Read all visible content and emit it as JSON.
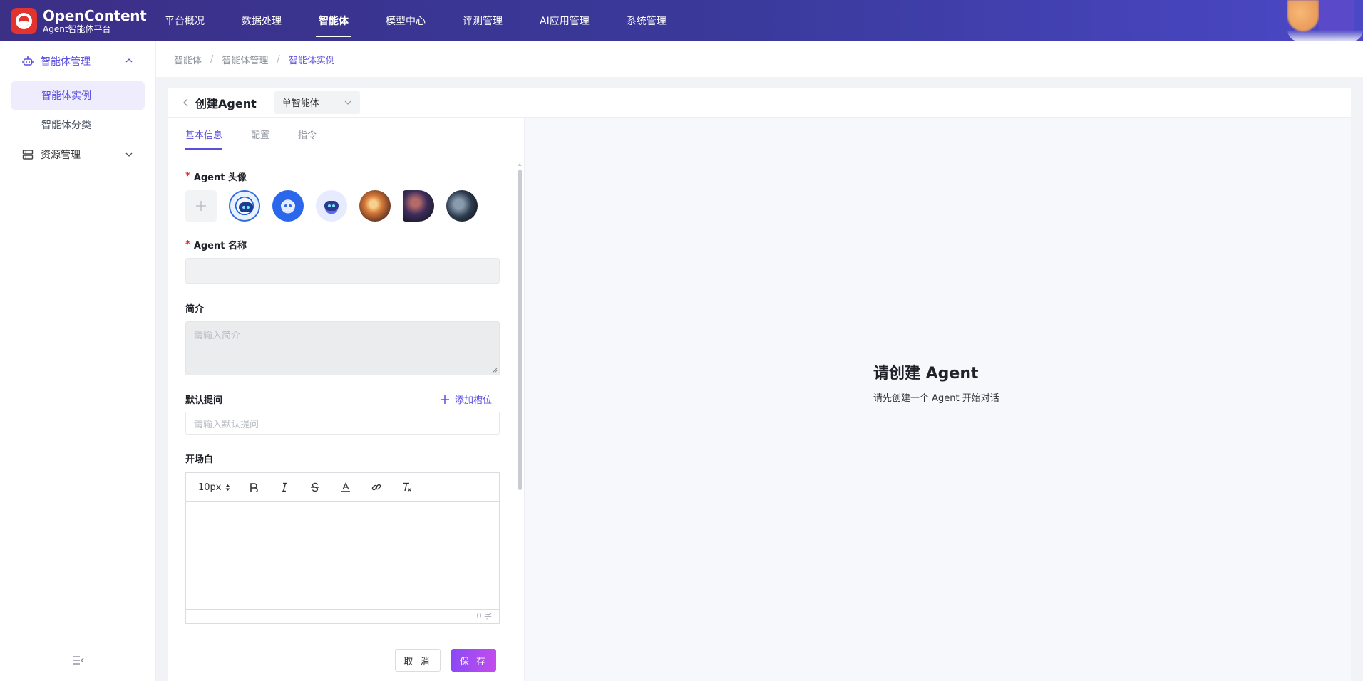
{
  "app": {
    "logo_title": "OpenContent",
    "logo_subtitle": "Agent智能体平台",
    "brand_color": "#e2332f",
    "accent_color": "#5a4ee0"
  },
  "nav": {
    "items": [
      {
        "label": "平台概况"
      },
      {
        "label": "数据处理"
      },
      {
        "label": "智能体",
        "active": true
      },
      {
        "label": "模型中心"
      },
      {
        "label": "评测管理"
      },
      {
        "label": "AI应用管理"
      },
      {
        "label": "系统管理"
      }
    ]
  },
  "sidebar": {
    "group1": {
      "label": "智能体管理",
      "icon": "robot-icon"
    },
    "sub_items": [
      {
        "label": "智能体实例",
        "active": true
      },
      {
        "label": "智能体分类"
      }
    ],
    "group2": {
      "label": "资源管理",
      "icon": "server-icon"
    }
  },
  "breadcrumb": {
    "items": [
      "智能体",
      "智能体管理",
      "智能体实例"
    ],
    "separator": "/"
  },
  "editor_header": {
    "title": "创建Agent",
    "type_select": "单智能体"
  },
  "tabs": [
    {
      "label": "基本信息",
      "active": true
    },
    {
      "label": "配置"
    },
    {
      "label": "指令"
    }
  ],
  "form": {
    "avatar_label": "Agent 头像",
    "name_label": "Agent 名称",
    "name_value": "",
    "intro_label": "简介",
    "intro_placeholder": "请输入简介",
    "default_q_label": "默认提问",
    "add_slot_label": "添加槽位",
    "default_q_placeholder": "请输入默认提问",
    "opening_label": "开场白",
    "editor_font_size": "10px",
    "char_count": "0 字",
    "required_mark": "*"
  },
  "buttons": {
    "cancel": "取 消",
    "save": "保 存"
  },
  "empty_state": {
    "title": "请创建 Agent",
    "subtitle": "请先创建一个 Agent 开始对话"
  }
}
